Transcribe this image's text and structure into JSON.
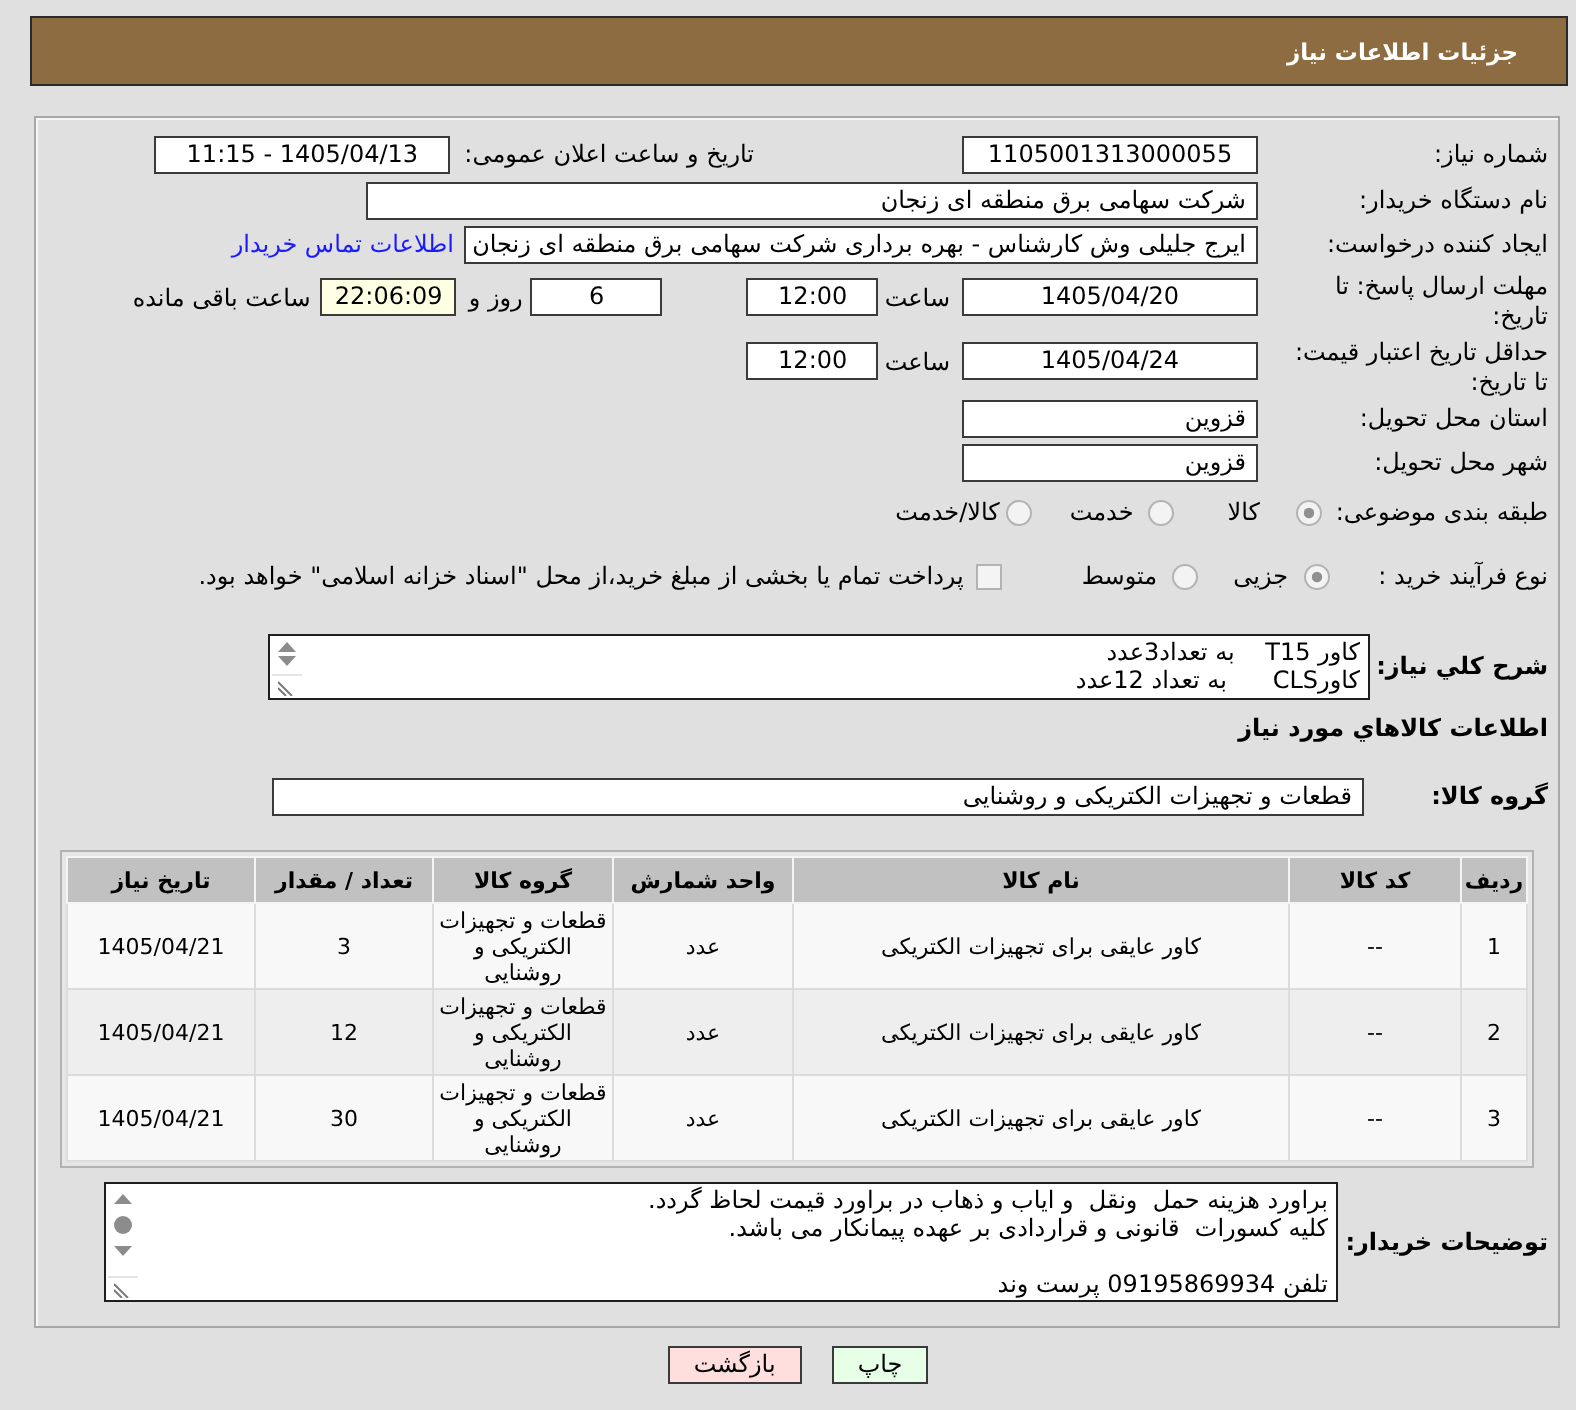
{
  "header": {
    "title": "جزئیات اطلاعات نیاز"
  },
  "details": {
    "need_number": {
      "label": "شماره نیاز:",
      "value": "1105001313000055"
    },
    "announcement": {
      "label": "تاریخ و ساعت اعلان عمومی:",
      "value": "1405/04/13 - 11:15"
    },
    "buyer": {
      "label": "نام دستگاه خریدار:",
      "value": "شرکت سهامی برق منطقه ای زنجان"
    },
    "requester": {
      "label": "ایجاد کننده درخواست:",
      "value": "ایرج جلیلی وش کارشناس - بهره برداری شرکت سهامی برق منطقه ای زنجان",
      "link": "اطلاعات تماس خریدار"
    },
    "reply_deadline": {
      "label": "مهلت ارسال پاسخ: تا تاریخ:",
      "date": "1405/04/20",
      "time_label": "ساعت",
      "time": "12:00",
      "days": "6",
      "days_label": "روز و",
      "remaining": "22:06:09",
      "remaining_label": "ساعت باقی مانده"
    },
    "price_validity": {
      "label": "حداقل تاریخ اعتبار قیمت: تا تاریخ:",
      "date": "1405/04/24",
      "time_label": "ساعت",
      "time": "12:00"
    },
    "delivery_province": {
      "label": "استان محل تحویل:",
      "value": "قزوین"
    },
    "delivery_city": {
      "label": "شهر محل تحویل:",
      "value": "قزوین"
    },
    "category": {
      "label": "طبقه بندی موضوعی:",
      "options": [
        {
          "label": "کالا",
          "selected": true
        },
        {
          "label": "خدمت",
          "selected": false
        },
        {
          "label": "کالا/خدمت",
          "selected": false
        }
      ]
    },
    "purchase_process": {
      "label": "نوع فرآیند خرید :",
      "options": [
        {
          "label": "جزیی",
          "selected": true
        },
        {
          "label": "متوسط",
          "selected": false
        }
      ],
      "treasury_payment": {
        "label": "پرداخت تمام یا بخشی از مبلغ خرید،از محل \"اسناد خزانه اسلامی\" خواهد بود.",
        "checked": false
      }
    },
    "description": {
      "label": "شرح کلي نياز:",
      "value": "کاور T15    به تعداد3عدد\nکاورCLS      به تعداد 12عدد"
    }
  },
  "goods": {
    "title": "اطلاعات کالاهاي مورد نياز",
    "group": {
      "label": "گروه کالا:",
      "value": "قطعات و تجهیزات الکتریکی و روشنایی"
    },
    "table": {
      "columns": [
        "ردیف",
        "کد کالا",
        "نام کالا",
        "واحد شمارش",
        "گروه کالا",
        "تعداد / مقدار",
        "تاریخ نیاز"
      ],
      "rows": [
        [
          "1",
          "--",
          "کاور عایقی برای تجهیزات الکتریکی",
          "عدد",
          "قطعات و تجهیزات الکتریکی و روشنایی",
          "3",
          "1405/04/21"
        ],
        [
          "2",
          "--",
          "کاور عایقی برای تجهیزات الکتریکی",
          "عدد",
          "قطعات و تجهیزات الکتریکی و روشنایی",
          "12",
          "1405/04/21"
        ],
        [
          "3",
          "--",
          "کاور عایقی برای تجهیزات الکتریکی",
          "عدد",
          "قطعات و تجهیزات الکتریکی و روشنایی",
          "30",
          "1405/04/21"
        ]
      ]
    }
  },
  "buyer_notes": {
    "label": "توضیحات خریدار:",
    "value": "براورد هزینه حمل  ونقل  و ایاب و ذهاب در براورد قیمت لحاظ گردد.\nکلیه کسورات  قانونی و قراردادی بر عهده پیمانکار می باشد.\n\nتلفن 09195869934 پرست وند"
  },
  "buttons": [
    {
      "label": "چاپ",
      "kind": "print"
    },
    {
      "label": "بازگشت",
      "kind": "back"
    }
  ]
}
